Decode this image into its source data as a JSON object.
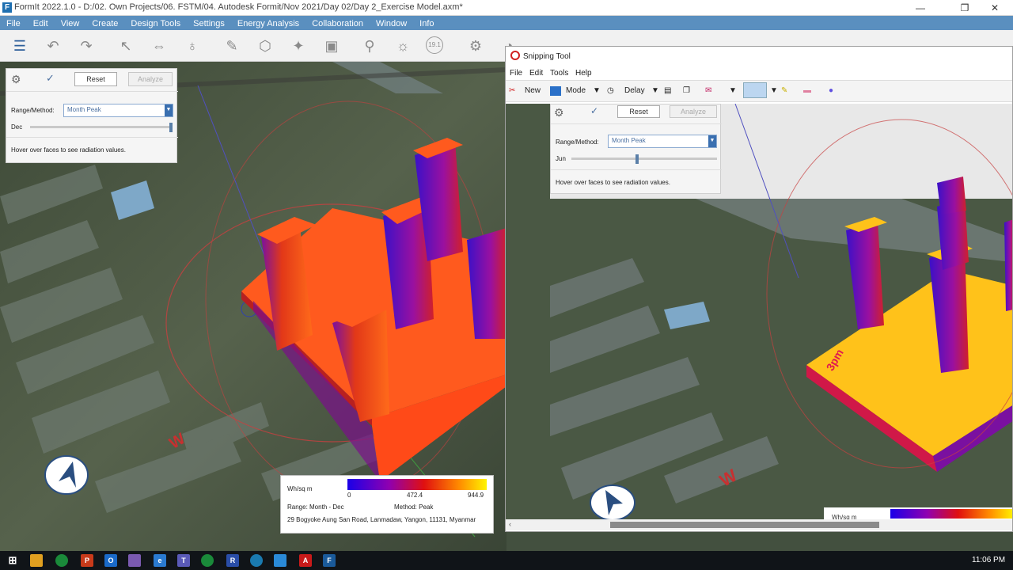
{
  "window": {
    "title": "FormIt 2022.1.0 - D:/02. Own Projects/06. FSTM/04. Autodesk Formit/Nov 2021/Day 02/Day 2_Exercise Model.axm*",
    "minimize": "—",
    "maximize": "❐",
    "close": "✕"
  },
  "menu": [
    "File",
    "Edit",
    "View",
    "Create",
    "Design Tools",
    "Settings",
    "Energy Analysis",
    "Collaboration",
    "Window",
    "Info"
  ],
  "toolbar": {
    "level_badge": "19.1"
  },
  "analysis_panel": {
    "reset_label": "Reset",
    "analyze_label": "Analyze",
    "range_label": "Range/Method:",
    "range_value": "Month Peak",
    "month_label": "Dec",
    "hint": "Hover over faces to see radiation values.",
    "slider_fraction": 1.0
  },
  "snipping_tool": {
    "title": "Snipping Tool",
    "menu": [
      "File",
      "Edit",
      "Tools",
      "Help"
    ],
    "new_label": "New",
    "mode_label": "Mode",
    "delay_label": "Delay",
    "inner_panel": {
      "reset_label": "Reset",
      "analyze_label": "Analyze",
      "range_label": "Range/Method:",
      "range_value": "Month Peak",
      "month_label": "Jun",
      "hint": "Hover over faces to see radiation values.",
      "slider_fraction": 0.45
    },
    "legend_partial": "Wh/sq m"
  },
  "legend": {
    "unit": "Wh/sq m",
    "ticks": [
      "0",
      "472.4",
      "944.9"
    ],
    "range": "Range: Month - Dec",
    "method": "Method: Peak",
    "address": "29 Bogyoke Aung San Road, Lanmadaw, Yangon, 11131, Myanmar"
  },
  "compass": {
    "left_letter": "W",
    "right_letter": "W",
    "time_label": "3pm"
  },
  "taskbar": {
    "clock": "11:06 PM"
  },
  "colors": {
    "menubar": "#5a8fbf",
    "heat_low": "#2b00e0",
    "heat_mid": "#e02020",
    "heat_high": "#fff000",
    "roof_orange": "#ff5a1e",
    "roof_yellow": "#ffc21a"
  }
}
